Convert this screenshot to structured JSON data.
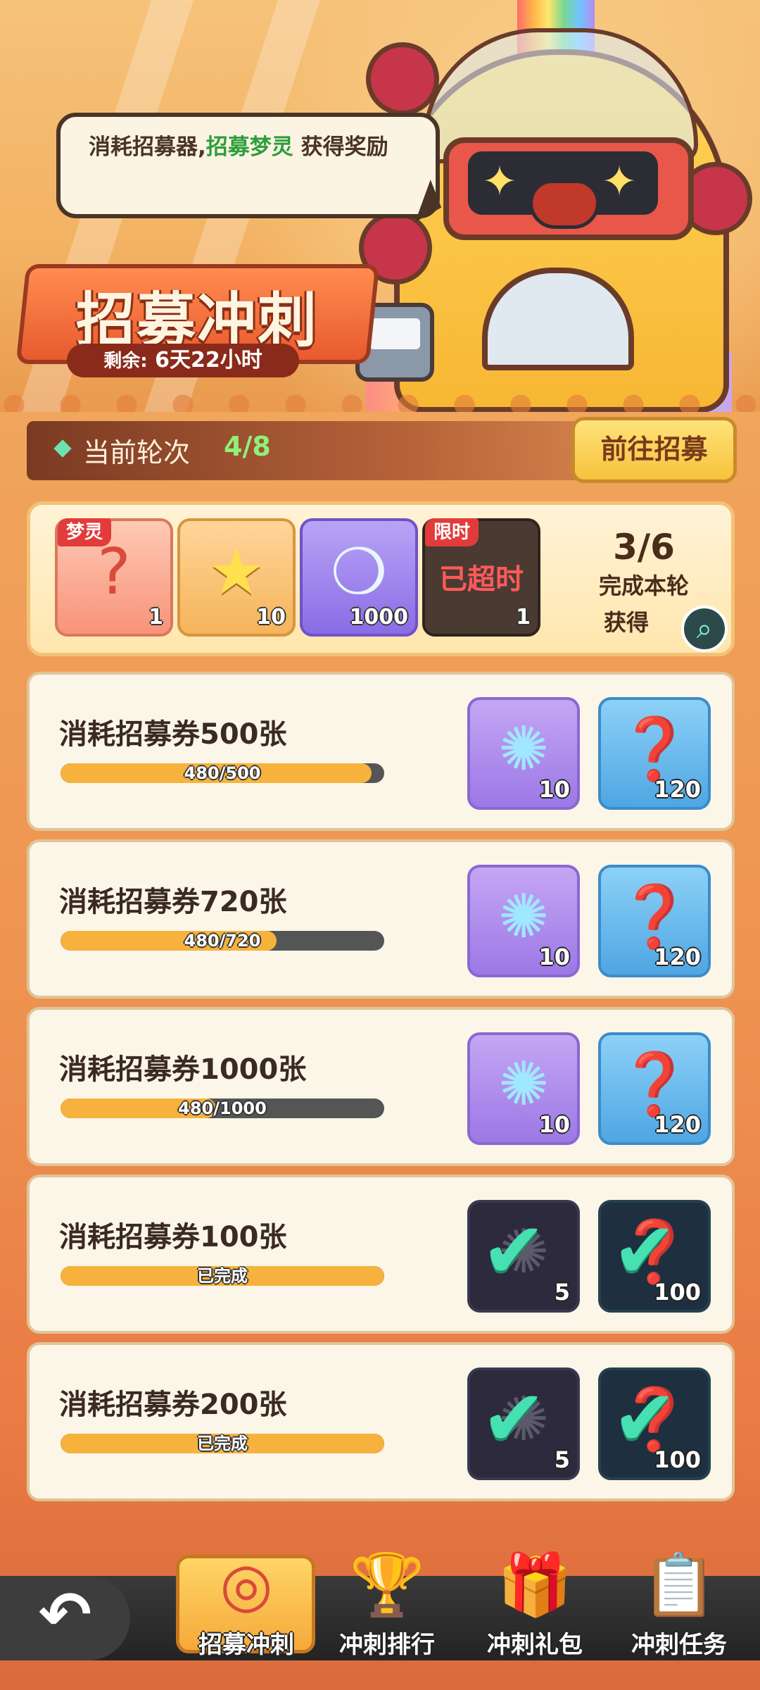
{
  "banner": {
    "speech": {
      "prefix": "消耗招募器,",
      "highlight": "招募梦灵",
      "suffix": " 获得奖励"
    },
    "title": "招募冲刺",
    "countdown_label": "剩余:",
    "countdown_value": "6天22小时"
  },
  "round": {
    "label": "当前轮次",
    "value": "4/8",
    "go_button": "前往招募"
  },
  "round_rewards": {
    "items": [
      {
        "tag": "梦灵",
        "icon": "mystery-chest-icon",
        "count": "1"
      },
      {
        "icon": "star-key-icon",
        "count": "10"
      },
      {
        "icon": "rainbow-bottle-icon",
        "count": "1000"
      },
      {
        "tag": "限时",
        "icon": "gift-bag-icon",
        "status": "已超时",
        "count": "1"
      }
    ],
    "progress": "3/6",
    "note_line1": "完成本轮",
    "note_line2": "获得"
  },
  "tasks": [
    {
      "title": "消耗招募券500张",
      "progress": 0.96,
      "progress_text": "480/500",
      "reward_a": "10",
      "reward_b": "120",
      "done": false
    },
    {
      "title": "消耗招募券720张",
      "progress": 0.667,
      "progress_text": "480/720",
      "reward_a": "10",
      "reward_b": "120",
      "done": false
    },
    {
      "title": "消耗招募券1000张",
      "progress": 0.48,
      "progress_text": "480/1000",
      "reward_a": "10",
      "reward_b": "120",
      "done": false
    },
    {
      "title": "消耗招募券100张",
      "progress": 1.0,
      "progress_text": "已完成",
      "reward_a": "5",
      "reward_b": "100",
      "done": true
    },
    {
      "title": "消耗招募券200张",
      "progress": 1.0,
      "progress_text": "已完成",
      "reward_a": "5",
      "reward_b": "100",
      "done": true
    }
  ],
  "nav": {
    "items": [
      {
        "label": "招募冲刺",
        "icon": "target-icon",
        "active": true
      },
      {
        "label": "冲刺排行",
        "icon": "trophy-icon"
      },
      {
        "label": "冲刺礼包",
        "icon": "gift-box-icon"
      },
      {
        "label": "冲刺任务",
        "icon": "clipboard-icon"
      }
    ]
  },
  "colors": {
    "accent": "#f6b23c",
    "highlight_green": "#2e9e3a",
    "round_value": "#8ff07a",
    "check": "#47e0b0"
  }
}
